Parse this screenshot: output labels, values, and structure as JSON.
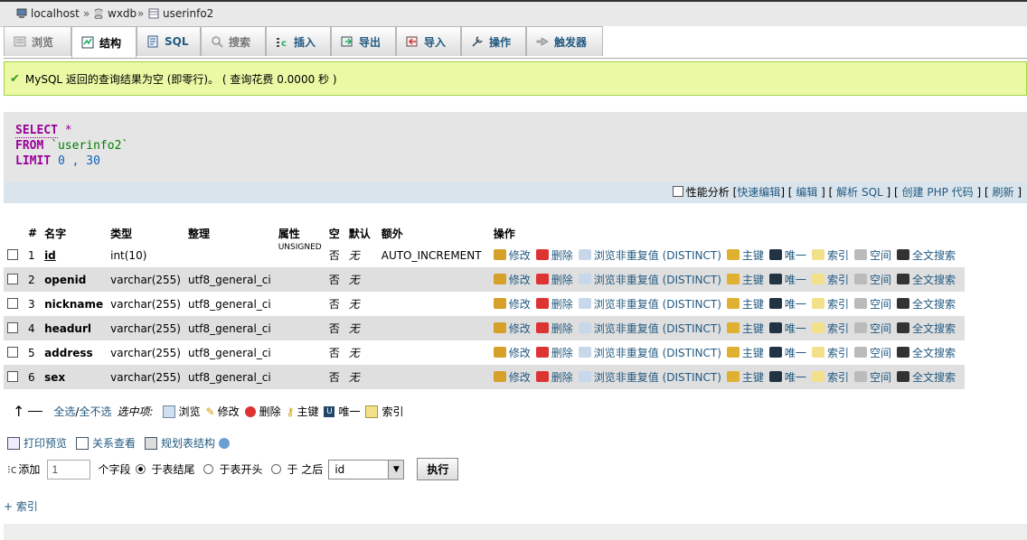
{
  "breadcrumb": {
    "server": "localhost",
    "database": "wxdb",
    "table": "userinfo2",
    "sep": "»"
  },
  "tabs": [
    {
      "label": "浏览",
      "icon": "browse-icon",
      "state": "disabled"
    },
    {
      "label": "结构",
      "icon": "structure-icon",
      "state": "active"
    },
    {
      "label": "SQL",
      "icon": "sql-icon",
      "state": "normal"
    },
    {
      "label": "搜索",
      "icon": "search-icon",
      "state": "disabled"
    },
    {
      "label": "插入",
      "icon": "insert-icon",
      "state": "normal"
    },
    {
      "label": "导出",
      "icon": "export-icon",
      "state": "normal"
    },
    {
      "label": "导入",
      "icon": "import-icon",
      "state": "normal"
    },
    {
      "label": "操作",
      "icon": "operations-icon",
      "state": "normal"
    },
    {
      "label": "触发器",
      "icon": "triggers-icon",
      "state": "normal"
    }
  ],
  "message": {
    "text": "MySQL 返回的查询结果为空 (即零行)。 ( 查询花费 0.0000 秒 )"
  },
  "sql": {
    "select": "SELECT",
    "star": " *",
    "from": "FROM",
    "table": " `userinfo2`",
    "limit": "LIMIT",
    "limit_a": " 0",
    "limit_b": " , 30"
  },
  "sqltools": {
    "profiling": "性能分析",
    "quick_edit": "快速编辑",
    "edit": "编辑",
    "explain": "解析 SQL",
    "php": "创建 PHP 代码",
    "refresh": "刷新"
  },
  "table": {
    "headers": {
      "num": "#",
      "name": "名字",
      "type": "类型",
      "collation": "整理",
      "attributes": "属性",
      "null": "空",
      "default": "默认",
      "extra": "额外",
      "action": "操作"
    },
    "actions": {
      "change": "修改",
      "drop": "删除",
      "distinct": "浏览非重复值 (DISTINCT)",
      "primary": "主键",
      "unique": "唯一",
      "index": "索引",
      "spatial": "空间",
      "fulltext": "全文搜索"
    },
    "rows": [
      {
        "num": "1",
        "name": "id",
        "type": "int(10)",
        "collation": "",
        "attributes": "UNSIGNED",
        "null": "否",
        "default": "无",
        "extra": "AUTO_INCREMENT"
      },
      {
        "num": "2",
        "name": "openid",
        "type": "varchar(255)",
        "collation": "utf8_general_ci",
        "attributes": "",
        "null": "否",
        "default": "无",
        "extra": ""
      },
      {
        "num": "3",
        "name": "nickname",
        "type": "varchar(255)",
        "collation": "utf8_general_ci",
        "attributes": "",
        "null": "否",
        "default": "无",
        "extra": ""
      },
      {
        "num": "4",
        "name": "headurl",
        "type": "varchar(255)",
        "collation": "utf8_general_ci",
        "attributes": "",
        "null": "否",
        "default": "无",
        "extra": ""
      },
      {
        "num": "5",
        "name": "address",
        "type": "varchar(255)",
        "collation": "utf8_general_ci",
        "attributes": "",
        "null": "否",
        "default": "无",
        "extra": ""
      },
      {
        "num": "6",
        "name": "sex",
        "type": "varchar(255)",
        "collation": "utf8_general_ci",
        "attributes": "",
        "null": "否",
        "default": "无",
        "extra": ""
      }
    ]
  },
  "bulk": {
    "check_all": "全选",
    "slash": " / ",
    "uncheck_all": "全不选",
    "with_selected": "选中项:",
    "browse": "浏览",
    "change": "修改",
    "drop": "删除",
    "primary": "主键",
    "unique": "唯一",
    "index": "索引"
  },
  "extras": {
    "print": "打印预览",
    "relation": "关系查看",
    "propose": "规划表结构"
  },
  "addfield": {
    "label": "添加",
    "count": "1",
    "fields": "个字段",
    "at_end": "于表结尾",
    "at_start": "于表开头",
    "after": "于 之后",
    "after_field": "id",
    "go": "执行"
  },
  "add_index": "+ 索引",
  "colors": {
    "accent": "#235a81",
    "keyword": "#990099",
    "success_bg": "#ebf8a4"
  }
}
